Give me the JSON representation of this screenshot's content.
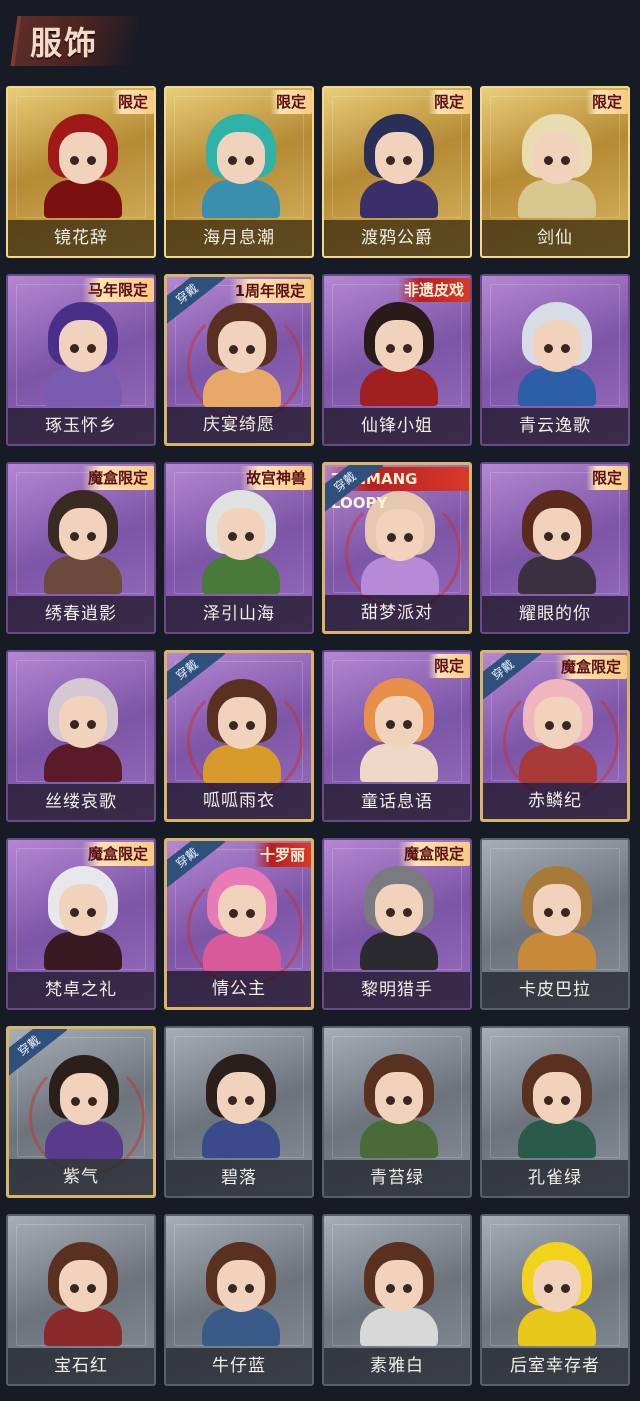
{
  "section_title": "服饰",
  "tags": {
    "limited": "限定",
    "horse_limited": "马年限定",
    "anniversary_limited": "1周年限定",
    "heritage": "非遗皮戏",
    "box_limited": "魔盒限定",
    "palace": "故宫神兽",
    "loopy": "ZANMANG LOOPY",
    "lolirot": "十罗丽"
  },
  "equipped_label": "穿戴",
  "colors": {
    "background": "#161b26",
    "gold_card": "#d9b763",
    "purple_card": "#9a6fc0",
    "grey_card": "#8a919a",
    "equipped_badge": "#2f4f7c"
  },
  "costumes": [
    {
      "name": "镜花辞",
      "tier": "gold",
      "tag": "限定",
      "equipped": false,
      "hair": "#a11818",
      "body": "#7a1010"
    },
    {
      "name": "海月息潮",
      "tier": "gold",
      "tag": "限定",
      "equipped": false,
      "hair": "#2fb3a8",
      "body": "#3a8fae"
    },
    {
      "name": "渡鸦公爵",
      "tier": "gold",
      "tag": "限定",
      "equipped": false,
      "hair": "#2a2f57",
      "body": "#3a2f6a"
    },
    {
      "name": "剑仙",
      "tier": "gold",
      "tag": "限定",
      "equipped": false,
      "hair": "#e8dcb0",
      "body": "#d8c890"
    },
    {
      "name": "琢玉怀乡",
      "tier": "purple",
      "tag": "马年限定",
      "equipped": false,
      "hair": "#4a2f8a",
      "body": "#7a5bb0"
    },
    {
      "name": "庆宴绮愿",
      "tier": "purple",
      "tag": "1周年限定",
      "equipped": true,
      "hair": "#5a3020",
      "body": "#e8a868"
    },
    {
      "name": "仙锋小姐",
      "tier": "purple",
      "tag": "非遗皮戏",
      "equipped": false,
      "hair": "#2a1a1a",
      "body": "#a02020"
    },
    {
      "name": "青云逸歌",
      "tier": "purple",
      "tag": "",
      "equipped": false,
      "hair": "#d8dce6",
      "body": "#2c5fa8"
    },
    {
      "name": "绣春逍影",
      "tier": "purple",
      "tag": "魔盒限定",
      "equipped": false,
      "hair": "#3a2a22",
      "body": "#6a4a3a"
    },
    {
      "name": "泽引山海",
      "tier": "purple",
      "tag": "故宫神兽",
      "equipped": false,
      "hair": "#dfe2e0",
      "body": "#4a7a3a"
    },
    {
      "name": "甜梦派对",
      "tier": "purple",
      "tag": "ZANMANG LOOPY",
      "equipped": true,
      "hair": "#e6c7b0",
      "body": "#b68ad6"
    },
    {
      "name": "耀眼的你",
      "tier": "purple",
      "tag": "限定",
      "equipped": false,
      "hair": "#5a2a1a",
      "body": "#3a3040"
    },
    {
      "name": "丝缕哀歌",
      "tier": "purple",
      "tag": "",
      "equipped": false,
      "hair": "#d6c8d2",
      "body": "#5a1a2a"
    },
    {
      "name": "呱呱雨衣",
      "tier": "purple",
      "tag": "",
      "equipped": true,
      "hair": "#5a3020",
      "body": "#d89a2a"
    },
    {
      "name": "童话息语",
      "tier": "purple",
      "tag": "限定",
      "equipped": false,
      "hair": "#e8904a",
      "body": "#f0d8c8"
    },
    {
      "name": "赤鳞纪",
      "tier": "purple",
      "tag": "魔盒限定",
      "equipped": true,
      "hair": "#f0b6c0",
      "body": "#a83a3a"
    },
    {
      "name": "梵卓之礼",
      "tier": "purple",
      "tag": "魔盒限定",
      "equipped": false,
      "hair": "#e8e8ec",
      "body": "#3a1a22"
    },
    {
      "name": "情公主",
      "tier": "purple",
      "tag": "十罗丽",
      "equipped": true,
      "hair": "#e87ab6",
      "body": "#d85a9a"
    },
    {
      "name": "黎明猎手",
      "tier": "purple",
      "tag": "魔盒限定",
      "equipped": false,
      "hair": "#7a7a80",
      "body": "#2a2a30"
    },
    {
      "name": "卡皮巴拉",
      "tier": "grey",
      "tag": "",
      "equipped": false,
      "hair": "#a87a3a",
      "body": "#c88a3a"
    },
    {
      "name": "紫气",
      "tier": "grey",
      "tag": "",
      "equipped": true,
      "hair": "#2a1f1a",
      "body": "#5a3a8a"
    },
    {
      "name": "碧落",
      "tier": "grey",
      "tag": "",
      "equipped": false,
      "hair": "#2a1f1a",
      "body": "#3a4a8a"
    },
    {
      "name": "青苔绿",
      "tier": "grey",
      "tag": "",
      "equipped": false,
      "hair": "#5a3020",
      "body": "#4a6a3a"
    },
    {
      "name": "孔雀绿",
      "tier": "grey",
      "tag": "",
      "equipped": false,
      "hair": "#5a3020",
      "body": "#2a5a4a"
    },
    {
      "name": "宝石红",
      "tier": "grey",
      "tag": "",
      "equipped": false,
      "hair": "#5a3020",
      "body": "#8a2a2a"
    },
    {
      "name": "牛仔蓝",
      "tier": "grey",
      "tag": "",
      "equipped": false,
      "hair": "#5a3020",
      "body": "#3a5a8a"
    },
    {
      "name": "素雅白",
      "tier": "grey",
      "tag": "",
      "equipped": false,
      "hair": "#5a3020",
      "body": "#d8d8d8"
    },
    {
      "name": "后室幸存者",
      "tier": "grey",
      "tag": "",
      "equipped": false,
      "hair": "#f2d21a",
      "body": "#e8c81a"
    }
  ]
}
